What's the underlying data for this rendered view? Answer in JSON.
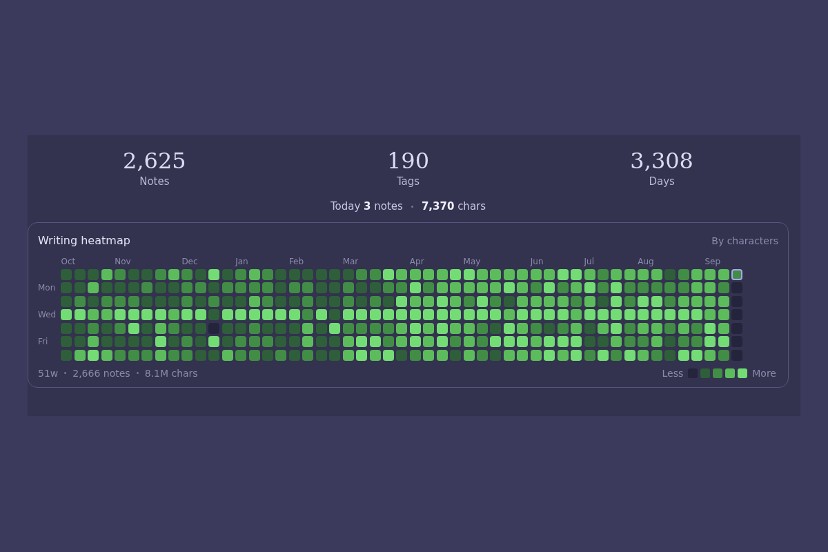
{
  "stats": [
    {
      "value": "2,625",
      "label": "Notes"
    },
    {
      "value": "190",
      "label": "Tags"
    },
    {
      "value": "3,308",
      "label": "Days"
    }
  ],
  "today": [
    "Today **3** notes",
    "**7,370** chars"
  ],
  "heatmap": {
    "title": "Writing heatmap",
    "mode": "By characters",
    "rows": [
      {
        "cells": [
          {
            "color": "#2f5e3a",
            "month": "Oct"
          },
          {
            "color": "#2f5e3a"
          },
          {
            "color": "#2f5e3a"
          },
          {
            "color": "#5cbc5c"
          },
          {
            "color": "#418d46",
            "month": "Nov"
          },
          {
            "color": "#2f5e3a"
          },
          {
            "color": "#2f5e3a"
          },
          {
            "color": "#418d46"
          },
          {
            "color": "#5cbc5c"
          },
          {
            "color": "#418d46",
            "month": "Dec"
          },
          {
            "color": "#2f5e3a"
          },
          {
            "color": "#74dc74"
          },
          {
            "color": "#2f5e3a"
          },
          {
            "color": "#418d46",
            "month": "Jan"
          },
          {
            "color": "#5cbc5c"
          },
          {
            "color": "#418d46"
          },
          {
            "color": "#2f5e3a"
          },
          {
            "color": "#2f5e3a",
            "month": "Feb"
          },
          {
            "color": "#2f5e3a"
          },
          {
            "color": "#2f5e3a"
          },
          {
            "color": "#2f5e3a"
          },
          {
            "color": "#2f5e3a",
            "month": "Mar"
          },
          {
            "color": "#418d46"
          },
          {
            "color": "#418d46"
          },
          {
            "color": "#74dc74"
          },
          {
            "color": "#5cbc5c"
          },
          {
            "color": "#5cbc5c",
            "month": "Apr"
          },
          {
            "color": "#5cbc5c"
          },
          {
            "color": "#5cbc5c"
          },
          {
            "color": "#74dc74"
          },
          {
            "color": "#74dc74",
            "month": "May"
          },
          {
            "color": "#5cbc5c"
          },
          {
            "color": "#5cbc5c"
          },
          {
            "color": "#5cbc5c"
          },
          {
            "color": "#5cbc5c"
          },
          {
            "color": "#5cbc5c",
            "month": "Jun"
          },
          {
            "color": "#5cbc5c"
          },
          {
            "color": "#74dc74"
          },
          {
            "color": "#74dc74"
          },
          {
            "color": "#5cbc5c",
            "month": "Jul"
          },
          {
            "color": "#418d46"
          },
          {
            "color": "#5cbc5c"
          },
          {
            "color": "#5cbc5c"
          },
          {
            "color": "#5cbc5c",
            "month": "Aug"
          },
          {
            "color": "#5cbc5c"
          },
          {
            "color": "#2f5e3a"
          },
          {
            "color": "#418d46"
          },
          {
            "color": "#5cbc5c"
          },
          {
            "color": "#5cbc5c",
            "month": "Sep"
          },
          {
            "color": "#5cbc5c"
          }
        ]
      },
      {
        "label": "Mon",
        "cells": [
          {
            "color": "#2f5e3a"
          },
          {
            "color": "#2f5e3a"
          },
          {
            "color": "#5cbc5c"
          },
          {
            "color": "#2f5e3a"
          },
          {
            "color": "#2f5e3a"
          },
          {
            "color": "#2f5e3a"
          },
          {
            "color": "#418d46"
          },
          {
            "color": "#2f5e3a"
          },
          {
            "color": "#2f5e3a"
          },
          {
            "color": "#418d46"
          },
          {
            "color": "#418d46"
          },
          {
            "color": "#2f5e3a"
          },
          {
            "color": "#418d46"
          },
          {
            "color": "#418d46"
          },
          {
            "color": "#418d46"
          },
          {
            "color": "#418d46"
          },
          {
            "color": "#2f5e3a"
          },
          {
            "color": "#418d46"
          },
          {
            "color": "#418d46"
          },
          {
            "color": "#2f5e3a"
          },
          {
            "color": "#2f5e3a"
          },
          {
            "color": "#418d46"
          },
          {
            "color": "#2f5e3a"
          },
          {
            "color": "#2f5e3a"
          },
          {
            "color": "#418d46"
          },
          {
            "color": "#418d46"
          },
          {
            "color": "#74dc74"
          },
          {
            "color": "#418d46"
          },
          {
            "color": "#5cbc5c"
          },
          {
            "color": "#5cbc5c"
          },
          {
            "color": "#5cbc5c"
          },
          {
            "color": "#5cbc5c"
          },
          {
            "color": "#5cbc5c"
          },
          {
            "color": "#74dc74"
          },
          {
            "color": "#5cbc5c"
          },
          {
            "color": "#418d46"
          },
          {
            "color": "#74dc74"
          },
          {
            "color": "#418d46"
          },
          {
            "color": "#5cbc5c"
          },
          {
            "color": "#74dc74"
          },
          {
            "color": "#418d46"
          },
          {
            "color": "#74dc74"
          },
          {
            "color": "#418d46"
          },
          {
            "color": "#418d46"
          },
          {
            "color": "#418d46"
          },
          {
            "color": "#418d46"
          },
          {
            "color": "#418d46"
          },
          {
            "color": "#5cbc5c"
          },
          {
            "color": "#5cbc5c"
          },
          {
            "color": "#418d46"
          },
          {
            "color": "#25243d"
          }
        ]
      },
      {
        "cells": [
          {
            "color": "#2f5e3a"
          },
          {
            "color": "#418d46"
          },
          {
            "color": "#2f5e3a"
          },
          {
            "color": "#418d46"
          },
          {
            "color": "#418d46"
          },
          {
            "color": "#418d46"
          },
          {
            "color": "#2f5e3a"
          },
          {
            "color": "#2f5e3a"
          },
          {
            "color": "#2f5e3a"
          },
          {
            "color": "#418d46"
          },
          {
            "color": "#2f5e3a"
          },
          {
            "color": "#418d46"
          },
          {
            "color": "#2f5e3a"
          },
          {
            "color": "#2f5e3a"
          },
          {
            "color": "#5cbc5c"
          },
          {
            "color": "#418d46"
          },
          {
            "color": "#2f5e3a"
          },
          {
            "color": "#2f5e3a"
          },
          {
            "color": "#418d46"
          },
          {
            "color": "#2f5e3a"
          },
          {
            "color": "#2f5e3a"
          },
          {
            "color": "#418d46"
          },
          {
            "color": "#2f5e3a"
          },
          {
            "color": "#418d46"
          },
          {
            "color": "#2f5e3a"
          },
          {
            "color": "#74dc74"
          },
          {
            "color": "#5cbc5c"
          },
          {
            "color": "#5cbc5c"
          },
          {
            "color": "#74dc74"
          },
          {
            "color": "#5cbc5c"
          },
          {
            "color": "#418d46"
          },
          {
            "color": "#74dc74"
          },
          {
            "color": "#418d46"
          },
          {
            "color": "#2f5e3a"
          },
          {
            "color": "#5cbc5c"
          },
          {
            "color": "#5cbc5c"
          },
          {
            "color": "#5cbc5c"
          },
          {
            "color": "#5cbc5c"
          },
          {
            "color": "#418d46"
          },
          {
            "color": "#5cbc5c"
          },
          {
            "color": "#2f5e3a"
          },
          {
            "color": "#74dc74"
          },
          {
            "color": "#418d46"
          },
          {
            "color": "#74dc74"
          },
          {
            "color": "#74dc74"
          },
          {
            "color": "#418d46"
          },
          {
            "color": "#5cbc5c"
          },
          {
            "color": "#5cbc5c"
          },
          {
            "color": "#5cbc5c"
          },
          {
            "color": "#5cbc5c"
          },
          {
            "color": "#25243d"
          }
        ]
      },
      {
        "label": "Wed",
        "cells": [
          {
            "color": "#74dc74"
          },
          {
            "color": "#74dc74"
          },
          {
            "color": "#5cbc5c"
          },
          {
            "color": "#5cbc5c"
          },
          {
            "color": "#74dc74"
          },
          {
            "color": "#74dc74"
          },
          {
            "color": "#74dc74"
          },
          {
            "color": "#74dc74"
          },
          {
            "color": "#5cbc5c"
          },
          {
            "color": "#74dc74"
          },
          {
            "color": "#74dc74"
          },
          {
            "color": "#2f5e3a"
          },
          {
            "color": "#74dc74"
          },
          {
            "color": "#74dc74"
          },
          {
            "color": "#74dc74"
          },
          {
            "color": "#74dc74"
          },
          {
            "color": "#74dc74"
          },
          {
            "color": "#74dc74"
          },
          {
            "color": "#418d46"
          },
          {
            "color": "#74dc74"
          },
          {
            "color": "#2f5e3a"
          },
          {
            "color": "#74dc74"
          },
          {
            "color": "#74dc74"
          },
          {
            "color": "#74dc74"
          },
          {
            "color": "#74dc74"
          },
          {
            "color": "#74dc74"
          },
          {
            "color": "#74dc74"
          },
          {
            "color": "#74dc74"
          },
          {
            "color": "#74dc74"
          },
          {
            "color": "#74dc74"
          },
          {
            "color": "#74dc74"
          },
          {
            "color": "#74dc74"
          },
          {
            "color": "#74dc74"
          },
          {
            "color": "#5cbc5c"
          },
          {
            "color": "#74dc74"
          },
          {
            "color": "#74dc74"
          },
          {
            "color": "#74dc74"
          },
          {
            "color": "#74dc74"
          },
          {
            "color": "#5cbc5c"
          },
          {
            "color": "#74dc74"
          },
          {
            "color": "#74dc74"
          },
          {
            "color": "#74dc74"
          },
          {
            "color": "#74dc74"
          },
          {
            "color": "#74dc74"
          },
          {
            "color": "#74dc74"
          },
          {
            "color": "#74dc74"
          },
          {
            "color": "#74dc74"
          },
          {
            "color": "#74dc74"
          },
          {
            "color": "#5cbc5c"
          },
          {
            "color": "#5cbc5c"
          },
          {
            "color": "#25243d"
          }
        ]
      },
      {
        "cells": [
          {
            "color": "#2f5e3a"
          },
          {
            "color": "#2f5e3a"
          },
          {
            "color": "#418d46"
          },
          {
            "color": "#2f5e3a"
          },
          {
            "color": "#418d46"
          },
          {
            "color": "#74dc74"
          },
          {
            "color": "#2f5e3a"
          },
          {
            "color": "#5cbc5c"
          },
          {
            "color": "#418d46"
          },
          {
            "color": "#2f5e3a"
          },
          {
            "color": "#2f5e3a"
          },
          {
            "color": "#25243d"
          },
          {
            "color": "#2f5e3a"
          },
          {
            "color": "#2f5e3a"
          },
          {
            "color": "#418d46"
          },
          {
            "color": "#2f5e3a"
          },
          {
            "color": "#2f5e3a"
          },
          {
            "color": "#2f5e3a"
          },
          {
            "color": "#5cbc5c"
          },
          {
            "color": "#2f5e3a"
          },
          {
            "color": "#74dc74"
          },
          {
            "color": "#418d46"
          },
          {
            "color": "#418d46"
          },
          {
            "color": "#418d46"
          },
          {
            "color": "#418d46"
          },
          {
            "color": "#5cbc5c"
          },
          {
            "color": "#74dc74"
          },
          {
            "color": "#5cbc5c"
          },
          {
            "color": "#74dc74"
          },
          {
            "color": "#5cbc5c"
          },
          {
            "color": "#5cbc5c"
          },
          {
            "color": "#418d46"
          },
          {
            "color": "#2f5e3a"
          },
          {
            "color": "#74dc74"
          },
          {
            "color": "#5cbc5c"
          },
          {
            "color": "#418d46"
          },
          {
            "color": "#2f5e3a"
          },
          {
            "color": "#418d46"
          },
          {
            "color": "#5cbc5c"
          },
          {
            "color": "#2f5e3a"
          },
          {
            "color": "#5cbc5c"
          },
          {
            "color": "#74dc74"
          },
          {
            "color": "#418d46"
          },
          {
            "color": "#5cbc5c"
          },
          {
            "color": "#5cbc5c"
          },
          {
            "color": "#418d46"
          },
          {
            "color": "#5cbc5c"
          },
          {
            "color": "#418d46"
          },
          {
            "color": "#74dc74"
          },
          {
            "color": "#5cbc5c"
          },
          {
            "color": "#25243d"
          }
        ]
      },
      {
        "label": "Fri",
        "cells": [
          {
            "color": "#2f5e3a"
          },
          {
            "color": "#2f5e3a"
          },
          {
            "color": "#5cbc5c"
          },
          {
            "color": "#2f5e3a"
          },
          {
            "color": "#2f5e3a"
          },
          {
            "color": "#2f5e3a"
          },
          {
            "color": "#2f5e3a"
          },
          {
            "color": "#74dc74"
          },
          {
            "color": "#2f5e3a"
          },
          {
            "color": "#418d46"
          },
          {
            "color": "#2f5e3a"
          },
          {
            "color": "#74dc74"
          },
          {
            "color": "#2f5e3a"
          },
          {
            "color": "#418d46"
          },
          {
            "color": "#418d46"
          },
          {
            "color": "#418d46"
          },
          {
            "color": "#2f5e3a"
          },
          {
            "color": "#2f5e3a"
          },
          {
            "color": "#5cbc5c"
          },
          {
            "color": "#2f5e3a"
          },
          {
            "color": "#2f5e3a"
          },
          {
            "color": "#5cbc5c"
          },
          {
            "color": "#74dc74"
          },
          {
            "color": "#74dc74"
          },
          {
            "color": "#418d46"
          },
          {
            "color": "#5cbc5c"
          },
          {
            "color": "#74dc74"
          },
          {
            "color": "#5cbc5c"
          },
          {
            "color": "#74dc74"
          },
          {
            "color": "#418d46"
          },
          {
            "color": "#5cbc5c"
          },
          {
            "color": "#418d46"
          },
          {
            "color": "#74dc74"
          },
          {
            "color": "#74dc74"
          },
          {
            "color": "#74dc74"
          },
          {
            "color": "#5cbc5c"
          },
          {
            "color": "#74dc74"
          },
          {
            "color": "#74dc74"
          },
          {
            "color": "#74dc74"
          },
          {
            "color": "#2f5e3a"
          },
          {
            "color": "#2f5e3a"
          },
          {
            "color": "#5cbc5c"
          },
          {
            "color": "#418d46"
          },
          {
            "color": "#418d46"
          },
          {
            "color": "#5cbc5c"
          },
          {
            "color": "#2f5e3a"
          },
          {
            "color": "#418d46"
          },
          {
            "color": "#418d46"
          },
          {
            "color": "#74dc74"
          },
          {
            "color": "#74dc74"
          },
          {
            "color": "#25243d"
          }
        ]
      },
      {
        "cells": [
          {
            "color": "#2f5e3a"
          },
          {
            "color": "#5cbc5c"
          },
          {
            "color": "#74dc74"
          },
          {
            "color": "#5cbc5c"
          },
          {
            "color": "#418d46"
          },
          {
            "color": "#418d46"
          },
          {
            "color": "#418d46"
          },
          {
            "color": "#5cbc5c"
          },
          {
            "color": "#418d46"
          },
          {
            "color": "#418d46"
          },
          {
            "color": "#2f5e3a"
          },
          {
            "color": "#2f5e3a"
          },
          {
            "color": "#5cbc5c"
          },
          {
            "color": "#418d46"
          },
          {
            "color": "#418d46"
          },
          {
            "color": "#2f5e3a"
          },
          {
            "color": "#418d46"
          },
          {
            "color": "#2f5e3a"
          },
          {
            "color": "#418d46"
          },
          {
            "color": "#2f5e3a"
          },
          {
            "color": "#2f5e3a"
          },
          {
            "color": "#5cbc5c"
          },
          {
            "color": "#74dc74"
          },
          {
            "color": "#5cbc5c"
          },
          {
            "color": "#74dc74"
          },
          {
            "color": "#2f5e3a"
          },
          {
            "color": "#418d46"
          },
          {
            "color": "#5cbc5c"
          },
          {
            "color": "#5cbc5c"
          },
          {
            "color": "#2f5e3a"
          },
          {
            "color": "#5cbc5c"
          },
          {
            "color": "#418d46"
          },
          {
            "color": "#2f5e3a"
          },
          {
            "color": "#5cbc5c"
          },
          {
            "color": "#5cbc5c"
          },
          {
            "color": "#5cbc5c"
          },
          {
            "color": "#74dc74"
          },
          {
            "color": "#5cbc5c"
          },
          {
            "color": "#74dc74"
          },
          {
            "color": "#418d46"
          },
          {
            "color": "#74dc74"
          },
          {
            "color": "#418d46"
          },
          {
            "color": "#74dc74"
          },
          {
            "color": "#5cbc5c"
          },
          {
            "color": "#418d46"
          },
          {
            "color": "#2f5e3a"
          },
          {
            "color": "#74dc74"
          },
          {
            "color": "#74dc74"
          },
          {
            "color": "#5cbc5c"
          },
          {
            "color": "#418d46"
          },
          {
            "color": "#25243d"
          }
        ]
      }
    ],
    "today": {
      "color": "#418d46"
    },
    "footer": [
      "51w",
      "2,666 notes",
      "8.1M chars"
    ],
    "legend": {
      "less": "Less",
      "more": "More",
      "cells": [
        {
          "color": "#25243d"
        },
        {
          "color": "#2f5e3a"
        },
        {
          "color": "#418d46"
        },
        {
          "color": "#5cbc5c"
        },
        {
          "color": "#74dc74"
        }
      ]
    }
  }
}
